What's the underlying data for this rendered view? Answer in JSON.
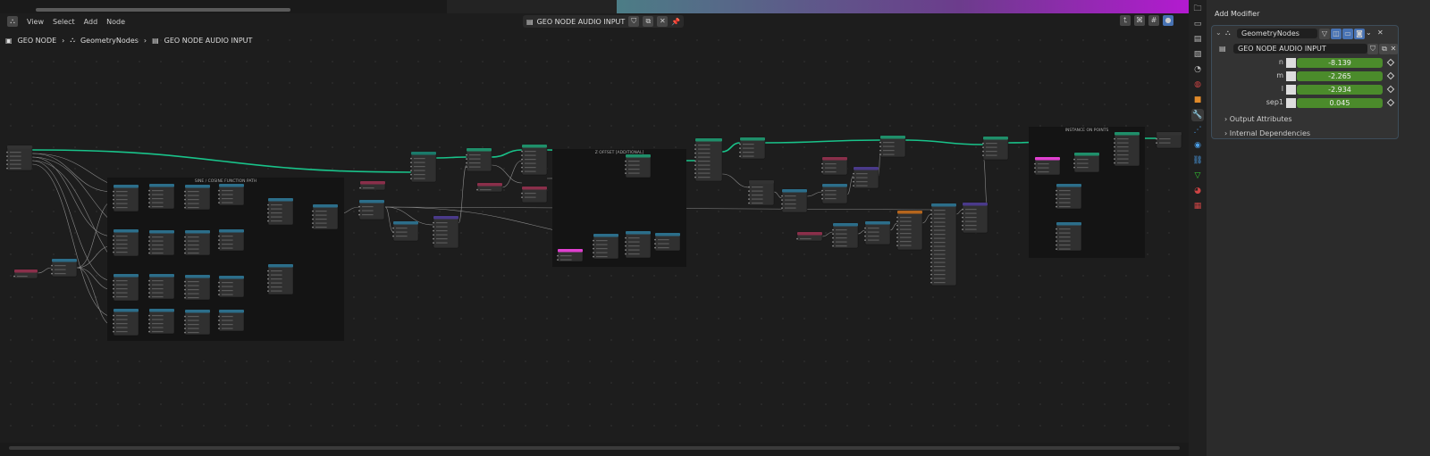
{
  "header": {
    "menus": [
      "View",
      "Select",
      "Add",
      "Node"
    ],
    "tree_name": "GEO NODE AUDIO INPUT"
  },
  "breadcrumb": [
    "GEO NODE",
    "GeometryNodes",
    "GEO NODE AUDIO INPUT"
  ],
  "frames": [
    "SINE / COSINE FUNCTION PATH",
    "Z OFFSET [ADDITIONAL]",
    "INSTANCE ON POINTS"
  ],
  "properties": {
    "add_modifier": "Add Modifier",
    "modifier_name": "GeometryNodes",
    "node_group": "GEO NODE AUDIO INPUT",
    "params": [
      {
        "label": "n",
        "value": "-8.139"
      },
      {
        "label": "m",
        "value": "-2.265"
      },
      {
        "label": "l",
        "value": "-2.934"
      },
      {
        "label": "sep1",
        "value": "0.045"
      }
    ],
    "output_attributes": "Output Attributes",
    "internal_dependencies": "Internal Dependencies"
  },
  "colors": {
    "geometry_link": "#19c38a",
    "value_green": "#4b8b2b",
    "accent": "#4772b3"
  }
}
